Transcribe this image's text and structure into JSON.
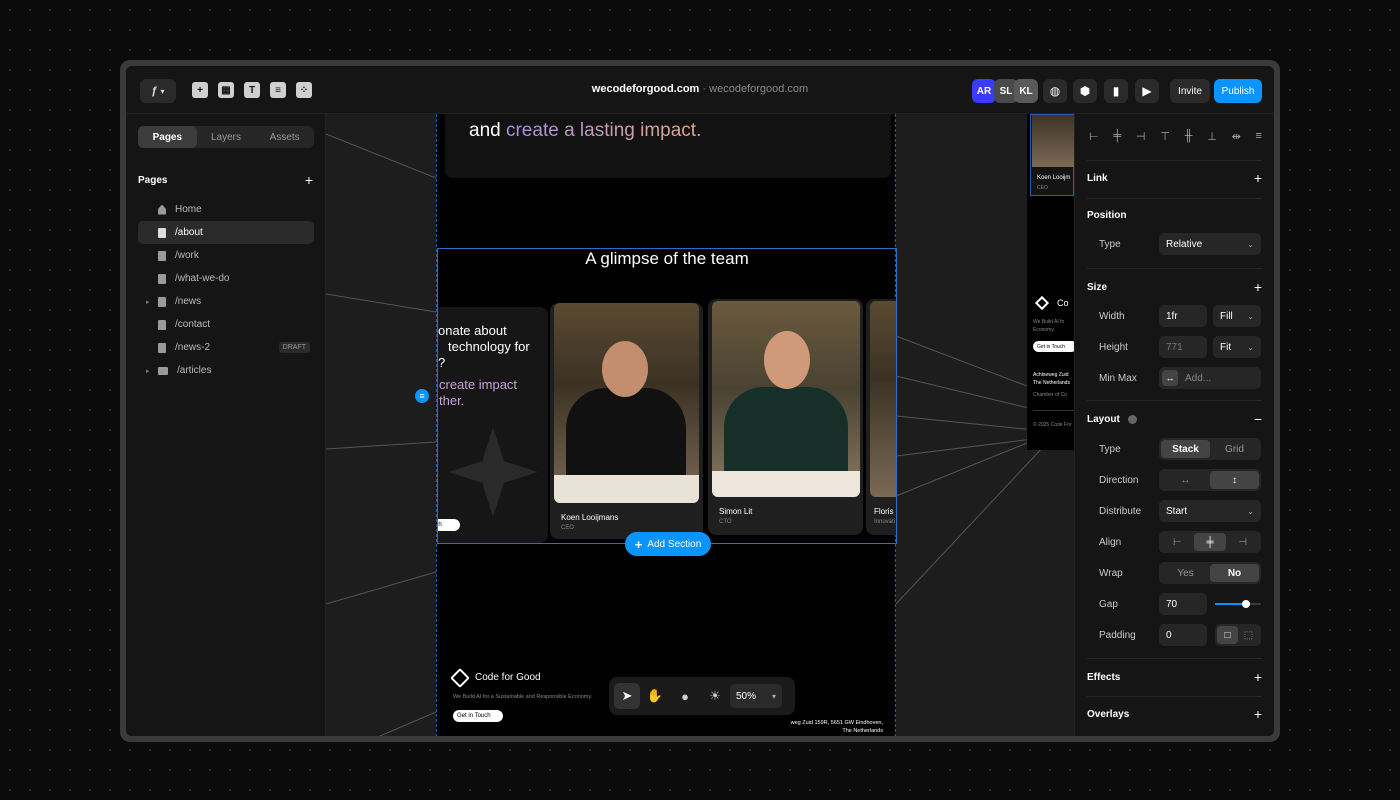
{
  "topbar": {
    "site_name": "wecodeforgood.com",
    "separator": "·",
    "site_sub": "wecodeforgood.com",
    "avatars": [
      {
        "initials": "AR",
        "color": "#3b3bff"
      },
      {
        "initials": "SL",
        "color": "#4a4a4a"
      },
      {
        "initials": "KL",
        "color": "#5a5a5a"
      }
    ],
    "invite_label": "Invite",
    "publish_label": "Publish",
    "accent_color": "#0a94ff"
  },
  "left": {
    "tabs": [
      "Pages",
      "Layers",
      "Assets"
    ],
    "active_tab": "Pages",
    "section_title": "Pages",
    "pages": [
      {
        "label": "Home",
        "icon": "home-icon"
      },
      {
        "label": "/about",
        "icon": "page-icon",
        "selected": true
      },
      {
        "label": "/work",
        "icon": "page-icon"
      },
      {
        "label": "/what-we-do",
        "icon": "page-icon"
      },
      {
        "label": "/news",
        "icon": "page-icon",
        "expandable": true
      },
      {
        "label": "/contact",
        "icon": "page-icon"
      },
      {
        "label": "/news-2",
        "icon": "page-icon",
        "badge": "DRAFT"
      },
      {
        "label": "/articles",
        "icon": "folder-icon",
        "expandable": true
      }
    ]
  },
  "canvas": {
    "hero_text_a": "and ",
    "hero_text_b": "create a lasting impact.",
    "team_title": "A glimpse of the team",
    "promo_line1": "onate about",
    "promo_line2": "technology for",
    "promo_line3": "?",
    "promo_line4": "create impact",
    "promo_line5": "ther.",
    "promo_cta": "uch",
    "team": [
      {
        "name": "Koen Looijmans",
        "role": "CEO"
      },
      {
        "name": "Simon Lit",
        "role": "CTO"
      },
      {
        "name": "Floris B",
        "role": "Innovati"
      }
    ],
    "add_section_label": "Add Section",
    "footer_brand": "Code for Good",
    "footer_tagline": "We Build AI for a Sustainable and Responsible Economy.",
    "footer_cta": "Get in Touch",
    "footer_addr1": "weg Zuid 159R, 5651 GW Eindhoven,",
    "footer_addr2": "The Netherlands",
    "zoom": "50%",
    "side_preview": {
      "name": "Koen Looijm",
      "role": "CEO",
      "brand": "Co",
      "tagline1": "We Build AI fo",
      "tagline2": "Economy.",
      "cta": "Get in Touch",
      "addr1": "Achtseweg Zuid",
      "addr2": "The Netherlands",
      "chamber": "Chamber of Co",
      "copyright": "© 2025 Code For"
    }
  },
  "right": {
    "link_label": "Link",
    "position_label": "Position",
    "type_label": "Type",
    "position_type": "Relative",
    "size_label": "Size",
    "width_label": "Width",
    "width_value": "1fr",
    "width_mode": "Fill",
    "height_label": "Height",
    "height_value": "771",
    "height_mode": "Fit",
    "minmax_label": "Min Max",
    "minmax_placeholder": "Add...",
    "layout_label": "Layout",
    "layout_type_label": "Type",
    "layout_types": [
      "Stack",
      "Grid"
    ],
    "direction_label": "Direction",
    "distribute_label": "Distribute",
    "distribute_value": "Start",
    "align_label": "Align",
    "wrap_label": "Wrap",
    "wrap_options": [
      "Yes",
      "No"
    ],
    "gap_label": "Gap",
    "gap_value": "70",
    "gap_slider_fraction": 0.68,
    "padding_label": "Padding",
    "padding_value": "0",
    "effects_label": "Effects",
    "overlays_label": "Overlays"
  }
}
